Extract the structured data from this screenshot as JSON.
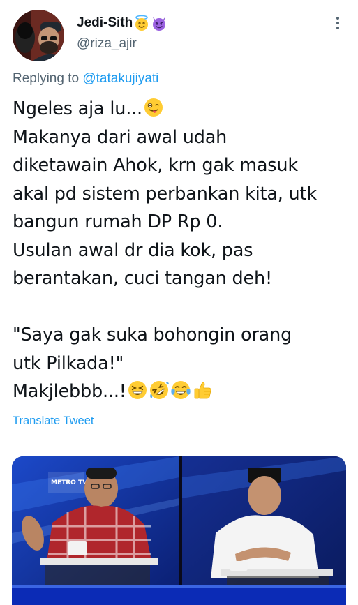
{
  "author": {
    "display_name": "Jedi-Sith",
    "handle": "@riza_ajir",
    "badges": [
      "smiling-face-with-halo-emoji",
      "smiling-imp-emoji"
    ]
  },
  "reply": {
    "prefix": "Replying to",
    "mention": "@tatakujiyati"
  },
  "tweet": {
    "lines": [
      "Ngeles aja lu...",
      "Makanya dari awal udah",
      "diketawain Ahok, krn gak masuk",
      "akal pd sistem perbankan kita, utk",
      "bangun rumah DP Rp 0.",
      "Usulan awal dr dia kok, pas",
      "berantakan, cuci tangan deh!",
      "",
      "\"Saya gak suka bohongin orang",
      "utk Pilkada!\"",
      "Makjlebbb...!"
    ],
    "line_emojis": {
      "0": [
        "winking-face-with-tongue-emoji"
      ],
      "10": [
        "grinning-squinting-face-emoji",
        "rolling-on-floor-laughing-emoji",
        "face-with-tears-of-joy-emoji",
        "thumbs-up-emoji"
      ]
    }
  },
  "translate_label": "Translate Tweet",
  "media": {
    "icon": "video-thumbnail",
    "channel_logo_text": "METRO TV"
  },
  "colors": {
    "text": "#0f1419",
    "secondary": "#536471",
    "accent": "#1d9bf0",
    "emoji_yellow": "#ffcc33"
  }
}
